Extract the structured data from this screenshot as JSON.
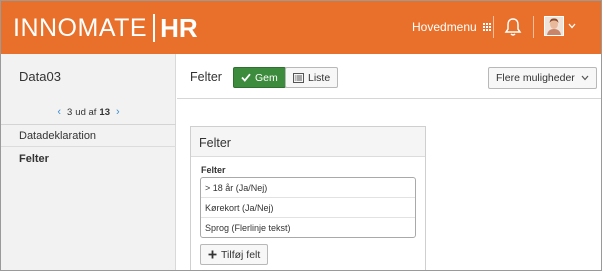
{
  "brand": {
    "logo_main": "INNOMATE",
    "logo_hr": "HR"
  },
  "topbar": {
    "menu_label": "Hovedmenu",
    "menu_icon": "grid-icon",
    "bell_icon": "bell-icon",
    "avatar_icon": "user-avatar",
    "caret_icon": "chevron-down-icon"
  },
  "sidebar": {
    "title": "Data03",
    "pager": {
      "current": "3",
      "of_word": "ud af",
      "total": "13",
      "prev_icon": "chevron-left-icon",
      "next_icon": "chevron-right-icon"
    },
    "items": [
      {
        "label": "Datadeklaration",
        "active": false
      },
      {
        "label": "Felter",
        "active": true
      }
    ]
  },
  "header": {
    "title": "Felter",
    "save_label": "Gem",
    "list_label": "Liste",
    "more_label": "Flere muligheder"
  },
  "panel": {
    "title": "Felter",
    "field_label": "Felter",
    "rows": [
      "> 18 år (Ja/Nej)",
      "Kørekort (Ja/Nej)",
      "Sprog (Flerlinje tekst)"
    ],
    "add_label": "Tilføj felt"
  },
  "colors": {
    "brand_orange": "#e8702a",
    "save_green": "#3d8b3d",
    "link_blue": "#3d8fd4"
  }
}
